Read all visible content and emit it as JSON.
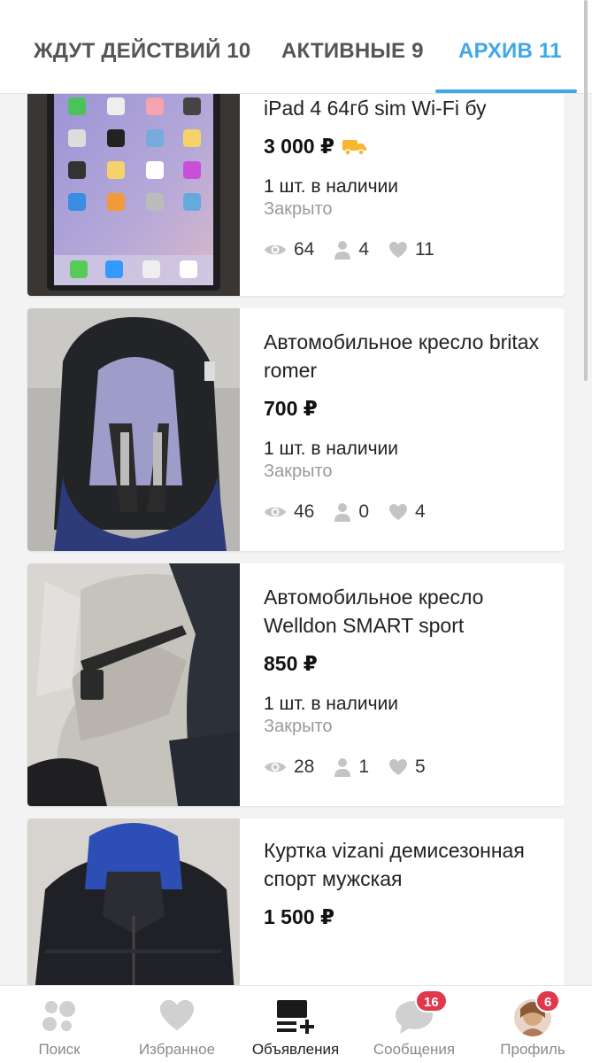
{
  "tabs": [
    {
      "label": "ЖДУТ ДЕЙСТВИЙ 10"
    },
    {
      "label": "АКТИВНЫЕ 9"
    },
    {
      "label": "АРХИВ 11"
    }
  ],
  "colors": {
    "accent": "#3fa8e8",
    "badge": "#e0394b",
    "truck": "#f7b731"
  },
  "listings": [
    {
      "title": "iPad 4 64гб sim Wi-Fi бу",
      "price": "3 000 ₽",
      "stock": "1 шт. в наличии",
      "status": "Закрыто",
      "views": "64",
      "contacts": "4",
      "likes": "11",
      "delivery_icon": "truck-icon"
    },
    {
      "title": "Автомобильное кресло britax romer",
      "price": "700 ₽",
      "stock": "1 шт. в наличии",
      "status": "Закрыто",
      "views": "46",
      "contacts": "0",
      "likes": "4"
    },
    {
      "title": "Автомобильное кресло Welldon SMART sport",
      "price": "850 ₽",
      "stock": "1 шт. в наличии",
      "status": "Закрыто",
      "views": "28",
      "contacts": "1",
      "likes": "5"
    },
    {
      "title": "Куртка vizani демисезонная спорт мужская",
      "price": "1 500 ₽"
    }
  ],
  "bottom_nav": [
    {
      "label": "Поиск",
      "icon": "search-dots-icon"
    },
    {
      "label": "Избранное",
      "icon": "heart-icon"
    },
    {
      "label": "Объявления",
      "icon": "listings-add-icon"
    },
    {
      "label": "Сообщения",
      "icon": "chat-bubble-icon",
      "badge": "16"
    },
    {
      "label": "Профиль",
      "icon": "avatar",
      "badge": "6"
    }
  ]
}
